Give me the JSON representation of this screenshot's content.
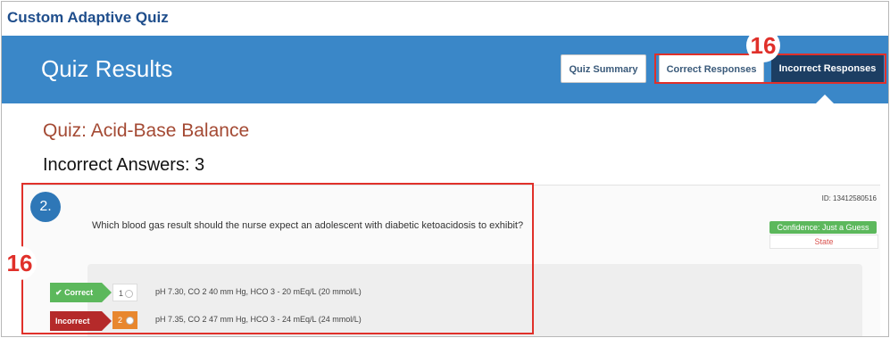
{
  "app": {
    "title": "Custom Adaptive Quiz"
  },
  "header": {
    "title": "Quiz Results",
    "buttons": {
      "summary": "Quiz Summary",
      "correct": "Correct Responses",
      "incorrect": "Incorrect Responses"
    }
  },
  "callouts": {
    "label": "16"
  },
  "quiz": {
    "name": "Quiz: Acid-Base Balance",
    "incorrect_label": "Incorrect Answers: 3"
  },
  "question": {
    "number": "2.",
    "id": "ID: 13412580516",
    "text": "Which blood gas result should the nurse expect an adolescent with diabetic ketoacidosis to exhibit?",
    "confidence": "Confidence: Just a Guess",
    "state": "State",
    "answers": [
      {
        "status": "Correct",
        "number": "1",
        "text": "pH 7.30, CO 2 40 mm Hg, HCO 3 - 20 mEq/L (20 mmol/L)"
      },
      {
        "status": "Incorrect",
        "number": "2",
        "text": "pH 7.35, CO 2 47 mm Hg, HCO 3 - 24 mEq/L (24 mmol/L)"
      }
    ]
  },
  "colors": {
    "banner": "#3a87c8",
    "active_tab": "#1c3e63",
    "highlight": "#e0302a",
    "correct": "#5cb85c",
    "incorrect": "#b52a2a",
    "selected_choice": "#e8872e"
  },
  "icons": {
    "correct_tag": "checkmark-icon",
    "choice_radio": "radio-icon"
  }
}
